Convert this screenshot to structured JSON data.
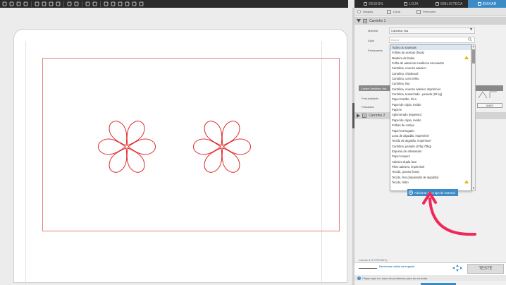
{
  "colors": {
    "accent": "#3c8bc6",
    "cut_line": "#e02a2a",
    "annotation": "#f0285a",
    "toolbar": "#2b2b2b"
  },
  "toolbar": {
    "icons": [
      "new-file-icon",
      "open-folder-icon",
      "save-icon",
      "library-icon",
      "cut-icon",
      "copy-icon",
      "paste-icon",
      "delete-icon",
      "undo-icon",
      "redo-icon",
      "magic-icon",
      "grid-icon",
      "zoom-in-icon",
      "zoom-out-icon",
      "zoom-drag-icon",
      "pan-icon",
      "download-icon",
      "fit-icon"
    ]
  },
  "tabs": [
    {
      "label": "DESIGN",
      "icon": "design-icon"
    },
    {
      "label": "LOJA",
      "icon": "store-icon"
    },
    {
      "label": "BIBLIOTECA",
      "icon": "library-icon"
    },
    {
      "label": "ENVIAR",
      "icon": "send-icon",
      "active": true
    }
  ],
  "modes": [
    {
      "label": "Simples"
    },
    {
      "label": "Linha"
    },
    {
      "label": "Preencher"
    }
  ],
  "section1": {
    "number": "1",
    "label": "Carrinho 1"
  },
  "fields": {
    "material_label": "Material",
    "material_value": "Cartolina, lisa",
    "action_label": "Ação",
    "search_placeholder": "Busca",
    "tool_label": "Ferramenta"
  },
  "material_list": {
    "items": [
      "Todos os materiais",
      "Folhas de acetato (finas)",
      "Madeira de balsa",
      "Folha de adesivos metálicos escovados",
      "Cartolina, reverso adesivo",
      "Cartolina, chipboard",
      "Cartolina, com brilho",
      "Cartolina, lisa",
      "Cartolina, reverso adesivo imprimível",
      "Cartolina, texturizada - pesada (20 kg)",
      "Papel Cartão, Fino",
      "Papel de cópia, médio",
      "Papel e",
      "Aglomerado (espesso)",
      "Papel de cópia, médio",
      "Folhas de cortiça",
      "Papel Corrugado",
      "Lona de algodão, imprimível",
      "Tecido de algodão, imprimível",
      "Cartolina, pesado (47kg 70kg)",
      "Espuma de artesanato",
      "Papel crepom",
      "Adesivo dupla face",
      "Filtro adesivo, imprimível",
      "Tecido, grosso (lona)",
      "Tecido, fino (impressão de algodão)",
      "Tecido, feltro"
    ],
    "selected_index": 0,
    "warning_rows": [
      2,
      26
    ],
    "add_button_label": "Adicionar novo tipo de material"
  },
  "background_panel": {
    "header": "Cortar Cartolina, lisa",
    "depth_label": "Profundidade",
    "pass_label": "Passadas",
    "more_button": "MAIS"
  },
  "section2": {
    "number": "2",
    "label": "Carrinho 2"
  },
  "bottom": {
    "status": "Cameo 5 (TYPEX9KT)",
    "media_status": "Nenhuma mídia carregada",
    "test_button": "TESTE",
    "help_text": "Clique aqui em caso de problemas para se conectar"
  }
}
